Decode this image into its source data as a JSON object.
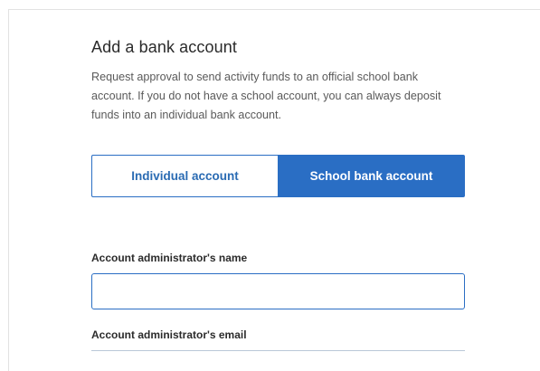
{
  "page": {
    "title": "Add a bank account",
    "description": "Request approval to send activity funds to an official school bank account. If you do not have a school account, you can always deposit funds into an individual bank account."
  },
  "account_type_toggle": {
    "options": [
      {
        "label": "Individual account",
        "selected": false
      },
      {
        "label": "School bank account",
        "selected": true
      }
    ]
  },
  "form": {
    "admin_name": {
      "label": "Account administrator's name",
      "value": "",
      "placeholder": ""
    },
    "admin_email": {
      "label": "Account administrator's email"
    }
  },
  "colors": {
    "accent": "#2a6ec4",
    "text": "#2b2b2b",
    "muted_text": "#5a5a5a"
  }
}
